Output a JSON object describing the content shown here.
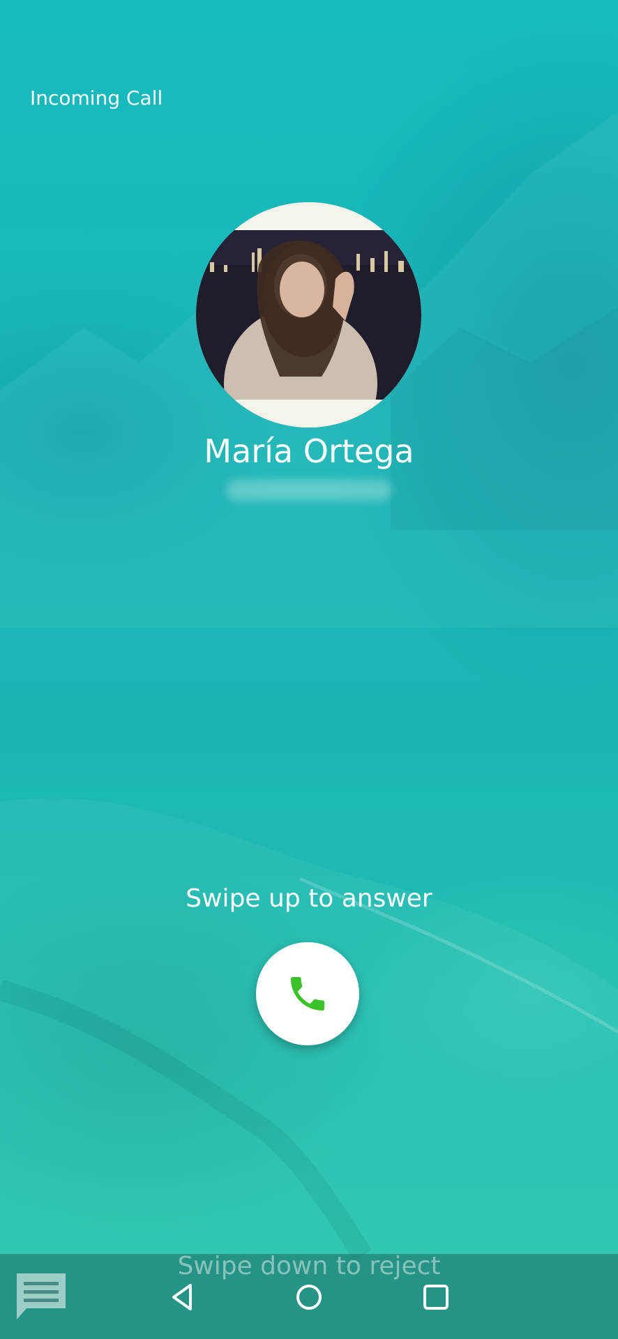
{
  "call": {
    "status": "Incoming Call",
    "caller_name": "María Ortega"
  },
  "actions": {
    "answer_hint": "Swipe up to answer",
    "reject_hint": "Swipe down to reject"
  },
  "icons": {
    "answer": "phone-icon",
    "message": "message-icon",
    "back": "back-icon",
    "home": "home-icon",
    "recent": "recent-apps-icon"
  },
  "colors": {
    "background": "#1ab6b8",
    "answer_icon": "#3bc12a",
    "button_bg": "#ffffff"
  }
}
